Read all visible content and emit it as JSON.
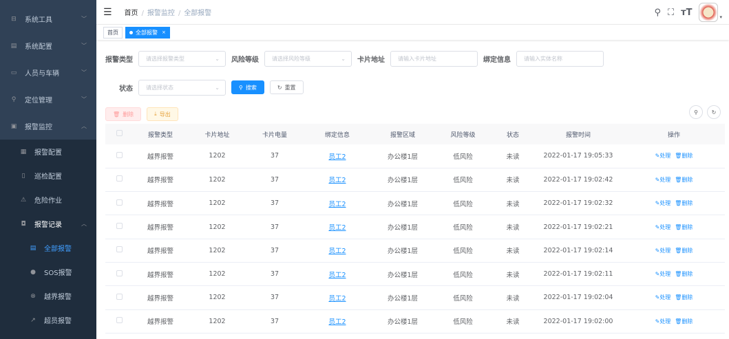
{
  "sidebar": {
    "items": [
      {
        "label": "系统工具",
        "icon": "briefcase-icon"
      },
      {
        "label": "系统配置",
        "icon": "config-icon"
      },
      {
        "label": "人员与车辆",
        "icon": "window-icon"
      },
      {
        "label": "定位管理",
        "icon": "location-icon"
      },
      {
        "label": "报警监控",
        "icon": "monitor-icon"
      }
    ],
    "sub": [
      {
        "label": "报警配置"
      },
      {
        "label": "巡检配置"
      },
      {
        "label": "危险作业"
      },
      {
        "label": "报警记录"
      }
    ],
    "sub2": [
      {
        "label": "全部报警"
      },
      {
        "label": "SOS报警"
      },
      {
        "label": "越界报警"
      },
      {
        "label": "超员报警"
      }
    ]
  },
  "breadcrumb": [
    "首页",
    "报警监控",
    "全部报警"
  ],
  "tags": [
    "首页",
    "全部报警"
  ],
  "filters": {
    "type_label": "报警类型",
    "type_ph": "请选择报警类型",
    "risk_label": "风险等级",
    "risk_ph": "请选择风险等级",
    "card_label": "卡片地址",
    "card_ph": "请输入卡片地址",
    "bind_label": "绑定信息",
    "bind_ph": "请输入实体名称",
    "status_label": "状态",
    "status_ph": "请选择状态",
    "search": "搜索",
    "reset": "重置"
  },
  "actions": {
    "delete": "删除",
    "export": "导出"
  },
  "table": {
    "headers": [
      "报警类型",
      "卡片地址",
      "卡片电量",
      "绑定信息",
      "报警区域",
      "风险等级",
      "状态",
      "报警时间",
      "操作"
    ],
    "op_handle": "处理",
    "op_delete": "删除",
    "rows": [
      [
        "越界报警",
        "1202",
        "37",
        "员工2",
        "办公楼1层",
        "低风险",
        "未读",
        "2022-01-17 19:05:33"
      ],
      [
        "越界报警",
        "1202",
        "37",
        "员工2",
        "办公楼1层",
        "低风险",
        "未读",
        "2022-01-17 19:02:42"
      ],
      [
        "越界报警",
        "1202",
        "37",
        "员工2",
        "办公楼1层",
        "低风险",
        "未读",
        "2022-01-17 19:02:32"
      ],
      [
        "越界报警",
        "1202",
        "37",
        "员工2",
        "办公楼1层",
        "低风险",
        "未读",
        "2022-01-17 19:02:21"
      ],
      [
        "越界报警",
        "1202",
        "37",
        "员工2",
        "办公楼1层",
        "低风险",
        "未读",
        "2022-01-17 19:02:14"
      ],
      [
        "越界报警",
        "1202",
        "37",
        "员工2",
        "办公楼1层",
        "低风险",
        "未读",
        "2022-01-17 19:02:11"
      ],
      [
        "越界报警",
        "1202",
        "37",
        "员工2",
        "办公楼1层",
        "低风险",
        "未读",
        "2022-01-17 19:02:04"
      ],
      [
        "越界报警",
        "1202",
        "37",
        "员工2",
        "办公楼1层",
        "低风险",
        "未读",
        "2022-01-17 19:02:00"
      ]
    ]
  }
}
